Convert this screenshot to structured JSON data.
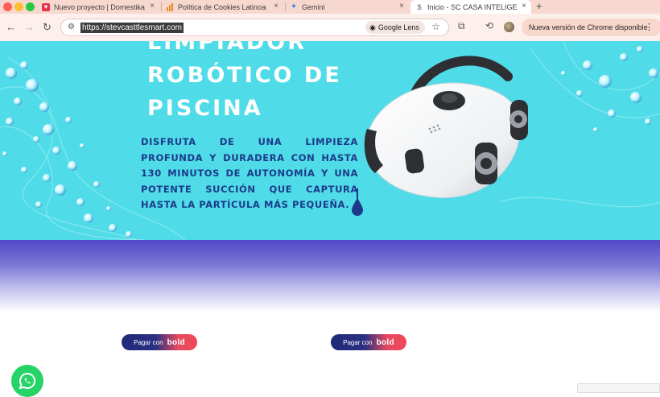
{
  "browser": {
    "tabs": [
      {
        "title": "Nuevo proyecto | Domestika",
        "icon": "domestika-icon"
      },
      {
        "title": "Política de Cookies Latinoam",
        "icon": "chart-icon"
      },
      {
        "title": "Gemini",
        "icon": "gemini-icon"
      },
      {
        "title": "Inicio - SC CASA INTELIGENTE",
        "icon": "site-icon",
        "active": true
      }
    ],
    "close_glyph": "×",
    "new_tab_glyph": "+",
    "url": "https://stevcasttlesmart.com",
    "google_lens_label": "Google Lens",
    "update_label": "Nueva versión de Chrome disponible",
    "menu_glyph": "⋮"
  },
  "hero": {
    "title_line_1": "LIMPIADOR",
    "title_line_2": "ROBÓTICO DE",
    "title_line_3": "PISCINA",
    "description": "Disfruta de una limpieza profunda y duradera con hasta 130 minutos de autonomía y una potente succión que captura hasta la partícula más pequeña.",
    "bg_color": "#4fdce8"
  },
  "payments": {
    "button_1": {
      "prefix": "Pagar con",
      "brand": "bold"
    },
    "button_2": {
      "prefix": "Pagar con",
      "brand": "bold"
    }
  },
  "colors": {
    "band_top": "#5247c7",
    "whatsapp": "#25d366"
  }
}
